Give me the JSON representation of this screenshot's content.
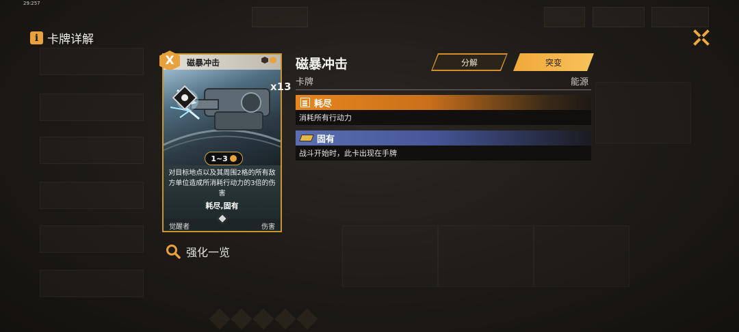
{
  "timestamp": "29:257",
  "header": {
    "title": "卡牌详解",
    "info_icon": "i"
  },
  "card": {
    "rarity": "X",
    "name": "磁暴冲击",
    "count": "x13",
    "range": "1~3",
    "description": "对目标地点以及其周围2格的所有敌方单位造成所消耗行动力的3倍的伤害",
    "keywords": "耗尽,固有",
    "footer_left": "觉醒者",
    "footer_right": "伤害"
  },
  "upgrade_link": "强化一览",
  "detail": {
    "name": "磁暴冲击",
    "type": "卡牌",
    "class": "能源",
    "buttons": {
      "decompose": "分解",
      "mutate": "突变"
    },
    "effects": [
      {
        "icon": "document-icon",
        "title": "耗尽",
        "desc": "消耗所有行动力"
      },
      {
        "icon": "card-icon",
        "title": "固有",
        "desc": "战斗开始时，此卡出现在手牌"
      }
    ]
  },
  "colors": {
    "accent": "#e9a23b",
    "effect_orange": "#e8861e",
    "effect_blue": "#5a6fb0"
  }
}
